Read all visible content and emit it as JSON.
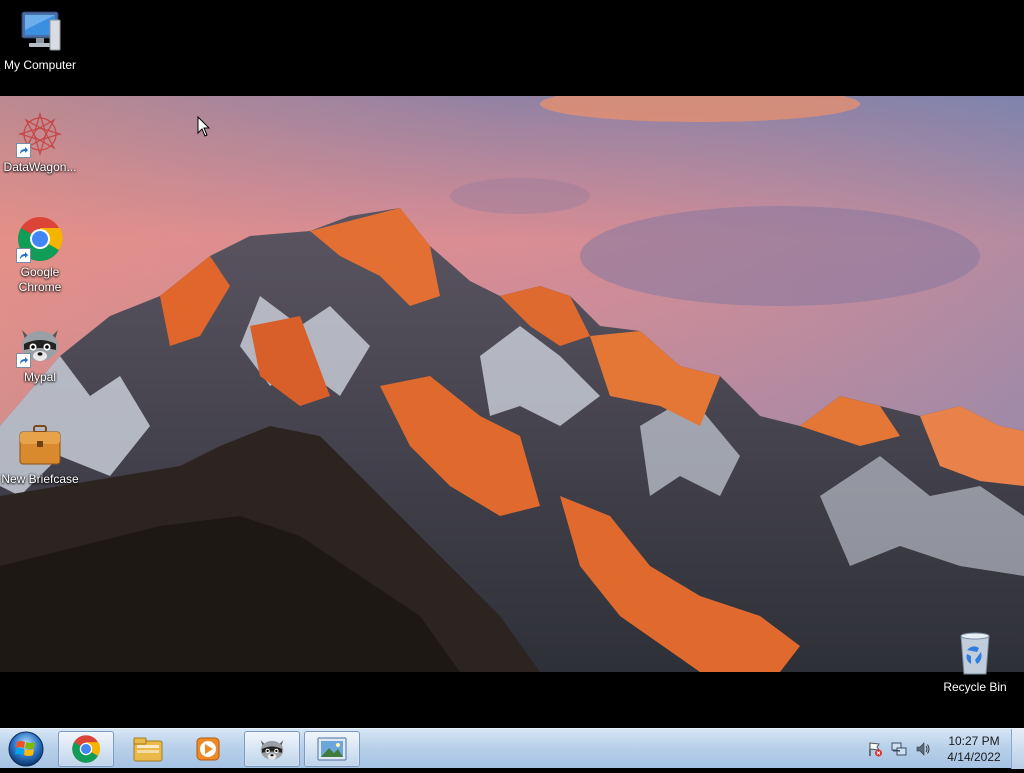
{
  "desktop": {
    "icons": [
      {
        "label": "My Computer",
        "icon": "computer-icon"
      },
      {
        "label": "DataWagon...",
        "icon": "datawagon-icon"
      },
      {
        "label": "Google Chrome",
        "icon": "chrome-icon"
      },
      {
        "label": "Mypal",
        "icon": "mypal-raccoon-icon"
      },
      {
        "label": "New Briefcase",
        "icon": "briefcase-icon"
      },
      {
        "label": "Recycle Bin",
        "icon": "recycle-bin-icon"
      }
    ],
    "wallpaper": "mountain-sunset",
    "colors": {
      "sky_top": "#6f7fa8",
      "sky_pink": "#e88f88",
      "rock_orange": "#e06a2e",
      "snow": "#dfe6f0"
    }
  },
  "taskbar": {
    "start": "windows-start-orb",
    "pinned": [
      {
        "icon": "chrome-icon",
        "active": true
      },
      {
        "icon": "file-explorer-icon",
        "active": false
      },
      {
        "icon": "media-player-icon",
        "active": false
      },
      {
        "icon": "mypal-raccoon-icon",
        "active": true
      },
      {
        "icon": "image-viewer-icon",
        "active": true
      }
    ],
    "tray": {
      "icons": [
        "action-center-flag-icon",
        "network-icon",
        "volume-icon"
      ],
      "time": "10:27 PM",
      "date": "4/14/2022"
    }
  }
}
